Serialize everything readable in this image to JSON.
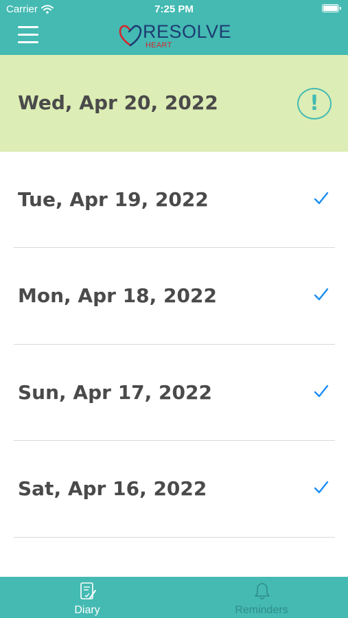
{
  "status_bar": {
    "carrier": "Carrier",
    "time": "7:25 PM",
    "icons": [
      "wifi-icon",
      "battery-icon"
    ]
  },
  "header": {
    "menu_icon": "hamburger-menu-icon",
    "logo": {
      "word": "RESOLVE",
      "sub": "HEART"
    }
  },
  "diary_entries": [
    {
      "date": "Wed, Apr 20, 2022",
      "status": "pending",
      "icon": "exclamation-circle-icon"
    },
    {
      "date": "Tue, Apr 19, 2022",
      "status": "done",
      "icon": "checkmark-icon"
    },
    {
      "date": "Mon, Apr 18, 2022",
      "status": "done",
      "icon": "checkmark-icon"
    },
    {
      "date": "Sun, Apr 17, 2022",
      "status": "done",
      "icon": "checkmark-icon"
    },
    {
      "date": "Sat, Apr 16, 2022",
      "status": "done",
      "icon": "checkmark-icon"
    }
  ],
  "alert_symbol": "!",
  "tab_bar": {
    "tabs": [
      {
        "label": "Diary",
        "icon": "diary-icon",
        "active": true
      },
      {
        "label": "Reminders",
        "icon": "bell-icon",
        "active": false
      }
    ]
  },
  "colors": {
    "brand_teal": "#44bab2",
    "current_row_bg": "#dcedb5",
    "check_blue": "#1a8df5",
    "logo_navy": "#1d3c72",
    "logo_red": "#d2282e"
  }
}
